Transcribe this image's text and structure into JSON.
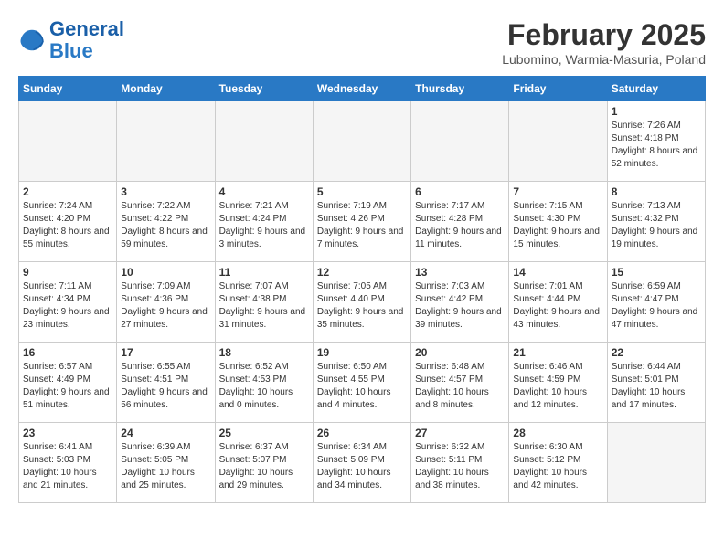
{
  "header": {
    "logo_line1": "General",
    "logo_line2": "Blue",
    "month_title": "February 2025",
    "location": "Lubomino, Warmia-Masuria, Poland"
  },
  "days_of_week": [
    "Sunday",
    "Monday",
    "Tuesday",
    "Wednesday",
    "Thursday",
    "Friday",
    "Saturday"
  ],
  "weeks": [
    [
      {
        "day": "",
        "info": ""
      },
      {
        "day": "",
        "info": ""
      },
      {
        "day": "",
        "info": ""
      },
      {
        "day": "",
        "info": ""
      },
      {
        "day": "",
        "info": ""
      },
      {
        "day": "",
        "info": ""
      },
      {
        "day": "1",
        "info": "Sunrise: 7:26 AM\nSunset: 4:18 PM\nDaylight: 8 hours and 52 minutes."
      }
    ],
    [
      {
        "day": "2",
        "info": "Sunrise: 7:24 AM\nSunset: 4:20 PM\nDaylight: 8 hours and 55 minutes."
      },
      {
        "day": "3",
        "info": "Sunrise: 7:22 AM\nSunset: 4:22 PM\nDaylight: 8 hours and 59 minutes."
      },
      {
        "day": "4",
        "info": "Sunrise: 7:21 AM\nSunset: 4:24 PM\nDaylight: 9 hours and 3 minutes."
      },
      {
        "day": "5",
        "info": "Sunrise: 7:19 AM\nSunset: 4:26 PM\nDaylight: 9 hours and 7 minutes."
      },
      {
        "day": "6",
        "info": "Sunrise: 7:17 AM\nSunset: 4:28 PM\nDaylight: 9 hours and 11 minutes."
      },
      {
        "day": "7",
        "info": "Sunrise: 7:15 AM\nSunset: 4:30 PM\nDaylight: 9 hours and 15 minutes."
      },
      {
        "day": "8",
        "info": "Sunrise: 7:13 AM\nSunset: 4:32 PM\nDaylight: 9 hours and 19 minutes."
      }
    ],
    [
      {
        "day": "9",
        "info": "Sunrise: 7:11 AM\nSunset: 4:34 PM\nDaylight: 9 hours and 23 minutes."
      },
      {
        "day": "10",
        "info": "Sunrise: 7:09 AM\nSunset: 4:36 PM\nDaylight: 9 hours and 27 minutes."
      },
      {
        "day": "11",
        "info": "Sunrise: 7:07 AM\nSunset: 4:38 PM\nDaylight: 9 hours and 31 minutes."
      },
      {
        "day": "12",
        "info": "Sunrise: 7:05 AM\nSunset: 4:40 PM\nDaylight: 9 hours and 35 minutes."
      },
      {
        "day": "13",
        "info": "Sunrise: 7:03 AM\nSunset: 4:42 PM\nDaylight: 9 hours and 39 minutes."
      },
      {
        "day": "14",
        "info": "Sunrise: 7:01 AM\nSunset: 4:44 PM\nDaylight: 9 hours and 43 minutes."
      },
      {
        "day": "15",
        "info": "Sunrise: 6:59 AM\nSunset: 4:47 PM\nDaylight: 9 hours and 47 minutes."
      }
    ],
    [
      {
        "day": "16",
        "info": "Sunrise: 6:57 AM\nSunset: 4:49 PM\nDaylight: 9 hours and 51 minutes."
      },
      {
        "day": "17",
        "info": "Sunrise: 6:55 AM\nSunset: 4:51 PM\nDaylight: 9 hours and 56 minutes."
      },
      {
        "day": "18",
        "info": "Sunrise: 6:52 AM\nSunset: 4:53 PM\nDaylight: 10 hours and 0 minutes."
      },
      {
        "day": "19",
        "info": "Sunrise: 6:50 AM\nSunset: 4:55 PM\nDaylight: 10 hours and 4 minutes."
      },
      {
        "day": "20",
        "info": "Sunrise: 6:48 AM\nSunset: 4:57 PM\nDaylight: 10 hours and 8 minutes."
      },
      {
        "day": "21",
        "info": "Sunrise: 6:46 AM\nSunset: 4:59 PM\nDaylight: 10 hours and 12 minutes."
      },
      {
        "day": "22",
        "info": "Sunrise: 6:44 AM\nSunset: 5:01 PM\nDaylight: 10 hours and 17 minutes."
      }
    ],
    [
      {
        "day": "23",
        "info": "Sunrise: 6:41 AM\nSunset: 5:03 PM\nDaylight: 10 hours and 21 minutes."
      },
      {
        "day": "24",
        "info": "Sunrise: 6:39 AM\nSunset: 5:05 PM\nDaylight: 10 hours and 25 minutes."
      },
      {
        "day": "25",
        "info": "Sunrise: 6:37 AM\nSunset: 5:07 PM\nDaylight: 10 hours and 29 minutes."
      },
      {
        "day": "26",
        "info": "Sunrise: 6:34 AM\nSunset: 5:09 PM\nDaylight: 10 hours and 34 minutes."
      },
      {
        "day": "27",
        "info": "Sunrise: 6:32 AM\nSunset: 5:11 PM\nDaylight: 10 hours and 38 minutes."
      },
      {
        "day": "28",
        "info": "Sunrise: 6:30 AM\nSunset: 5:12 PM\nDaylight: 10 hours and 42 minutes."
      },
      {
        "day": "",
        "info": ""
      }
    ]
  ]
}
